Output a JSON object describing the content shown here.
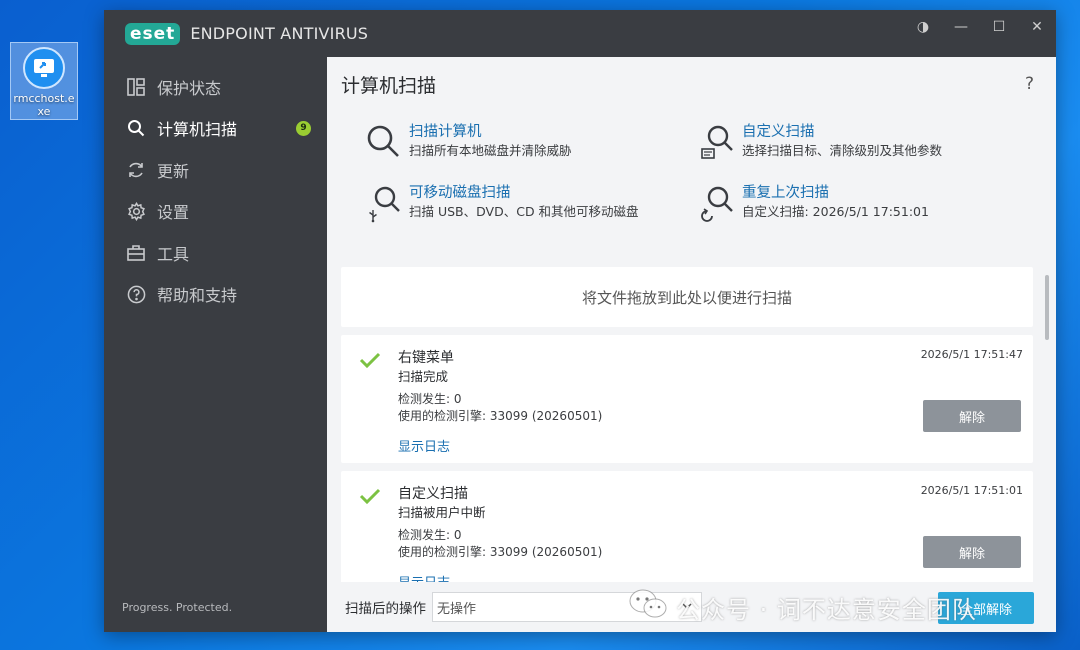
{
  "desktop": {
    "icon_label": "rmcchost.exe",
    "icon_name": "remote-desktop-icon"
  },
  "window": {
    "logo_text": "eset",
    "product_name": "ENDPOINT ANTIVIRUS",
    "controls": {
      "theme": "◑",
      "minimize": "—",
      "maximize": "☐",
      "close": "✕"
    }
  },
  "sidebar": {
    "items": [
      {
        "label": "保护状态",
        "icon": "dashboard-icon",
        "active": false
      },
      {
        "label": "计算机扫描",
        "icon": "search-icon",
        "active": true,
        "badge": "9"
      },
      {
        "label": "更新",
        "icon": "refresh-icon",
        "active": false
      },
      {
        "label": "设置",
        "icon": "gear-icon",
        "active": false
      },
      {
        "label": "工具",
        "icon": "briefcase-icon",
        "active": false
      },
      {
        "label": "帮助和支持",
        "icon": "help-circle-icon",
        "active": false
      }
    ],
    "tagline": "Progress. Protected."
  },
  "main": {
    "title": "计算机扫描",
    "help": "?",
    "actions": [
      {
        "title": "扫描计算机",
        "desc": "扫描所有本地磁盘并清除威胁"
      },
      {
        "title": "自定义扫描",
        "desc": "选择扫描目标、清除级别及其他参数"
      },
      {
        "title": "可移动磁盘扫描",
        "desc": "扫描 USB、DVD、CD 和其他可移动磁盘"
      },
      {
        "title": "重复上次扫描",
        "desc": "自定义扫描: 2026/5/1 17:51:01"
      }
    ],
    "dropzone": "将文件拖放到此处以便进行扫描",
    "scans": [
      {
        "title": "右键菜单",
        "status": "扫描完成",
        "detections": "检测发生: 0",
        "engine": "使用的检测引擎: 33099 (20260501)",
        "log_link": "显示日志",
        "time": "2026/5/1 17:51:47",
        "dismiss": "解除"
      },
      {
        "title": "自定义扫描",
        "status": "扫描被用户中断",
        "detections": "检测发生: 0",
        "engine": "使用的检测引擎: 33099 (20260501)",
        "log_link": "显示日志",
        "time": "2026/5/1 17:51:01",
        "dismiss": "解除"
      }
    ],
    "after_scan_label": "扫描后的操作",
    "after_scan_value": "无操作",
    "clear_all": "全部解除"
  },
  "watermark": "公众号 · 词不达意安全团队",
  "colors": {
    "accent": "#1a6fb0",
    "eset_teal": "#23a896",
    "badge": "#9acd32",
    "check": "#7cc242",
    "sidebar": "#3a3d42"
  }
}
